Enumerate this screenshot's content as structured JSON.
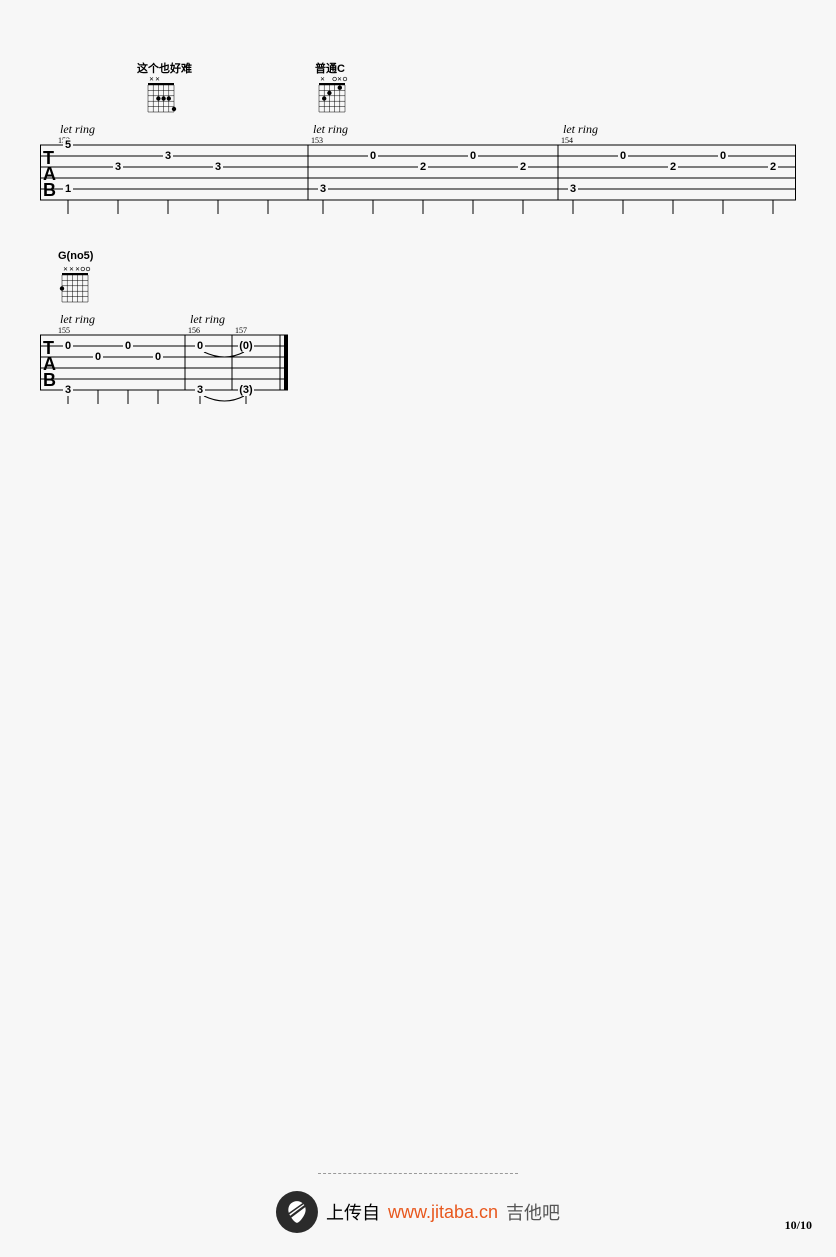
{
  "page_number": "10/10",
  "footer": {
    "upload_label": "上传自",
    "url": "www.jitaba.cn",
    "brand": "吉他吧"
  },
  "system1": {
    "chord1_label": "这个也好难",
    "chord2_label": "普通C",
    "let_ring_1": "let ring",
    "let_ring_2": "let ring",
    "let_ring_3": "let ring",
    "bar_nums": {
      "b152": "152",
      "b153": "153",
      "b154": "154"
    },
    "m1": {
      "n1": "5",
      "n2": "3",
      "n3": "3",
      "n4": "3",
      "n5": "1"
    },
    "m2": {
      "n1": "0",
      "n2": "2",
      "n3": "0",
      "n4": "2",
      "n5": "3"
    },
    "m3": {
      "n1": "0",
      "n2": "2",
      "n3": "0",
      "n4": "2",
      "n5": "3"
    }
  },
  "system2": {
    "chord_label": "G(no5)",
    "let_ring_1": "let ring",
    "let_ring_2": "let ring",
    "bar_nums": {
      "b155": "155",
      "b156": "156",
      "b157": "157"
    },
    "m1": {
      "n1": "0",
      "n2": "0",
      "n3": "0",
      "n4": "0",
      "n5": "3"
    },
    "m2": {
      "n1": "0",
      "n2": "(0)",
      "n3": "3",
      "n4": "(3)"
    }
  },
  "chart_data": {
    "type": "table",
    "instrument": "guitar",
    "notation": "tablature",
    "tuning_strings": 6,
    "systems": [
      {
        "measures": [
          {
            "number": 152,
            "chord_annotation": "这个也好难",
            "technique": "let ring",
            "notes": [
              {
                "string": 1,
                "fret": 5
              },
              {
                "string": 3,
                "fret": 3
              },
              {
                "string": 2,
                "fret": 3
              },
              {
                "string": 3,
                "fret": 3
              },
              {
                "string": 5,
                "fret": 1
              }
            ]
          },
          {
            "number": 153,
            "chord_annotation": "普通C",
            "technique": "let ring",
            "notes": [
              {
                "string": 2,
                "fret": 0
              },
              {
                "string": 3,
                "fret": 2
              },
              {
                "string": 2,
                "fret": 0
              },
              {
                "string": 3,
                "fret": 2
              },
              {
                "string": 5,
                "fret": 3
              }
            ]
          },
          {
            "number": 154,
            "technique": "let ring",
            "notes": [
              {
                "string": 2,
                "fret": 0
              },
              {
                "string": 3,
                "fret": 2
              },
              {
                "string": 2,
                "fret": 0
              },
              {
                "string": 3,
                "fret": 2
              },
              {
                "string": 5,
                "fret": 3
              }
            ]
          }
        ]
      },
      {
        "measures": [
          {
            "number": 155,
            "chord_annotation": "G(no5)",
            "technique": "let ring",
            "notes": [
              {
                "string": 2,
                "fret": 0
              },
              {
                "string": 3,
                "fret": 0
              },
              {
                "string": 2,
                "fret": 0
              },
              {
                "string": 3,
                "fret": 0
              },
              {
                "string": 6,
                "fret": 3
              }
            ]
          },
          {
            "number": 156,
            "technique": "let ring",
            "notes": [
              {
                "string": 2,
                "fret": 0,
                "tie_to_next": true
              },
              {
                "string": 6,
                "fret": 3,
                "tie_to_next": true
              }
            ]
          },
          {
            "number": 157,
            "notes": [
              {
                "string": 2,
                "fret": 0,
                "ghost": true
              },
              {
                "string": 6,
                "fret": 3,
                "ghost": true
              }
            ],
            "end": true
          }
        ]
      }
    ]
  }
}
